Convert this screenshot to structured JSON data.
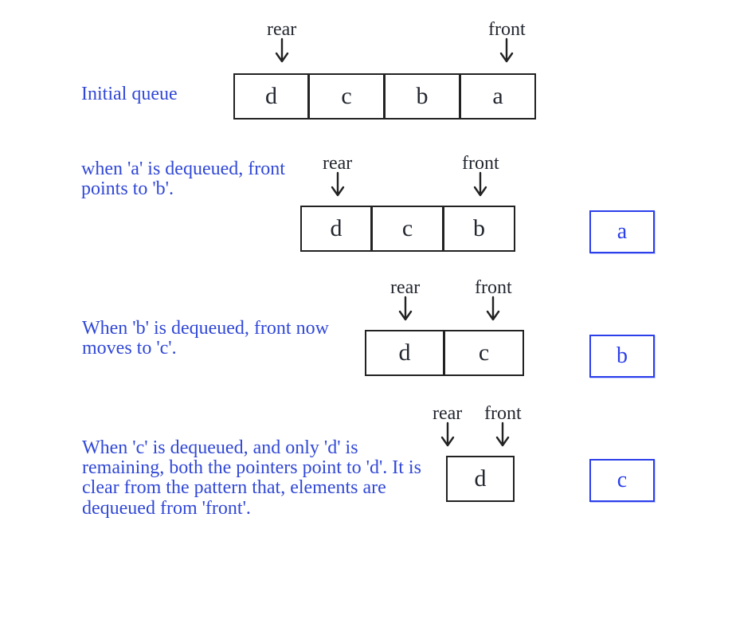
{
  "labels": {
    "rear": "rear",
    "front": "front"
  },
  "steps": [
    {
      "caption": "Initial queue",
      "cells": [
        "d",
        "c",
        "b",
        "a"
      ],
      "rear_index": 0,
      "front_index": 3,
      "dequeued": null
    },
    {
      "caption": "when 'a' is dequeued, front points to 'b'.",
      "cells": [
        "d",
        "c",
        "b"
      ],
      "rear_index": 0,
      "front_index": 2,
      "dequeued": "a"
    },
    {
      "caption": "When 'b' is dequeued, front now moves to 'c'.",
      "cells": [
        "d",
        "c"
      ],
      "rear_index": 0,
      "front_index": 1,
      "dequeued": "b"
    },
    {
      "caption": "When 'c' is dequeued, and only 'd' is remaining, both the pointers point to 'd'. It is clear from the pattern that, elements are dequeued from 'front'.",
      "cells": [
        "d"
      ],
      "rear_index": 0,
      "front_index": 0,
      "dequeued": "c"
    }
  ]
}
